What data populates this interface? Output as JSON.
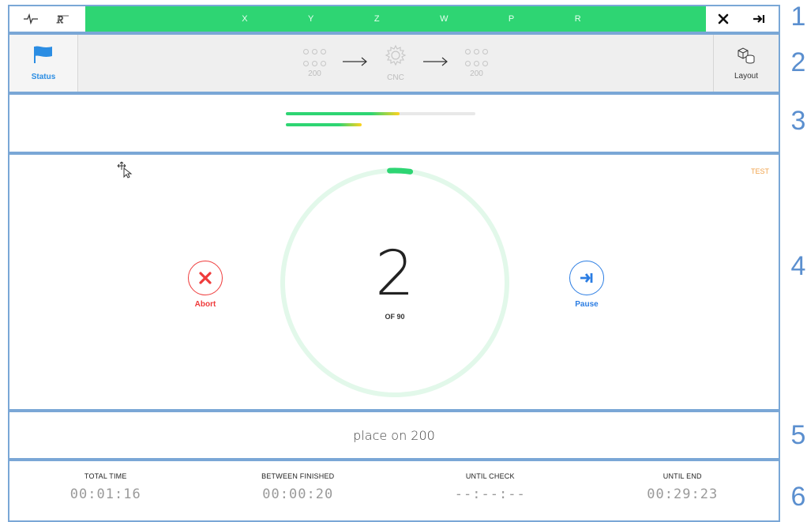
{
  "topbar": {
    "left_icons": [
      "pulse-icon",
      "r-logo-icon"
    ],
    "axes": [
      "X",
      "Y",
      "Z",
      "W",
      "P",
      "R"
    ],
    "right_icons": [
      "close-icon",
      "skip-to-end-icon"
    ],
    "axis_bar_color": "#2ed573"
  },
  "flowbar": {
    "status_label": "Status",
    "status_icon": "flag-icon",
    "source_label": "200",
    "machine_label": "CNC",
    "target_label": "200",
    "layout_label": "Layout",
    "layout_icon": "cubes-icon"
  },
  "progress": {
    "bar1": 0.6,
    "bar2": 0.4
  },
  "main": {
    "test_label": "TEST",
    "count": "2",
    "of_label": "OF 90",
    "count_fraction": 0.022,
    "abort_label": "Abort",
    "pause_label": "Pause",
    "abort_color": "#ef3b3b",
    "pause_color": "#2b7de3"
  },
  "instruction": "place on 200",
  "timers": [
    {
      "label": "TOTAL TIME",
      "value": "00:01:16"
    },
    {
      "label": "BETWEEN FINISHED",
      "value": "00:00:20"
    },
    {
      "label": "UNTIL CHECK",
      "value": "--:--:--"
    },
    {
      "label": "UNTIL END",
      "value": "00:29:23"
    }
  ],
  "section_numbers": [
    "1",
    "2",
    "3",
    "4",
    "5",
    "6"
  ]
}
